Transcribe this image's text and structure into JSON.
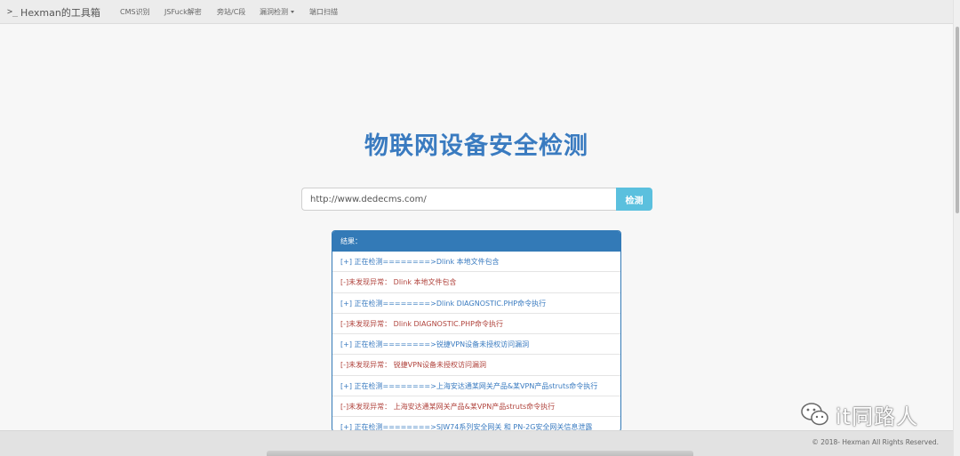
{
  "navbar": {
    "brand_icon": ">_",
    "brand": "Hexman的工具箱",
    "links": [
      "CMS识别",
      "JSFuck解密",
      "旁站/C段",
      "漏洞检测",
      "端口扫描"
    ]
  },
  "main": {
    "title": "物联网设备安全检测",
    "url_value": "http://www.dedecms.com/",
    "detect_label": "检测"
  },
  "results": {
    "heading": "结果：",
    "rows": [
      "[+] 正在检测========>Dlink 本地文件包含",
      "[-]未发现异常： Dlink 本地文件包含",
      "[+] 正在检测========>Dlink DIAGNOSTIC.PHP命令执行",
      "[-]未发现异常： Dlink DIAGNOSTIC.PHP命令执行",
      "[+] 正在检测========>锐捷VPN设备未授权访问漏洞",
      "[-]未发现异常： 锐捷VPN设备未授权访问漏洞",
      "[+] 正在检测========>上海安达通某网关产品&某VPN产品struts命令执行",
      "[-]未发现异常： 上海安达通某网关产品&某VPN产品struts命令执行",
      "[+] 正在检测========>SJW74系列安全网关 和 PN-2G安全网关信息泄露"
    ]
  },
  "footer": {
    "copyright": "© 2018- Hexman All Rights Reserved."
  },
  "watermark": {
    "text": "it同路人"
  },
  "colors": {
    "title": "#3a7bc0",
    "panel": "#337ab7",
    "button": "#5bc0de",
    "warn": "#b0433c"
  }
}
